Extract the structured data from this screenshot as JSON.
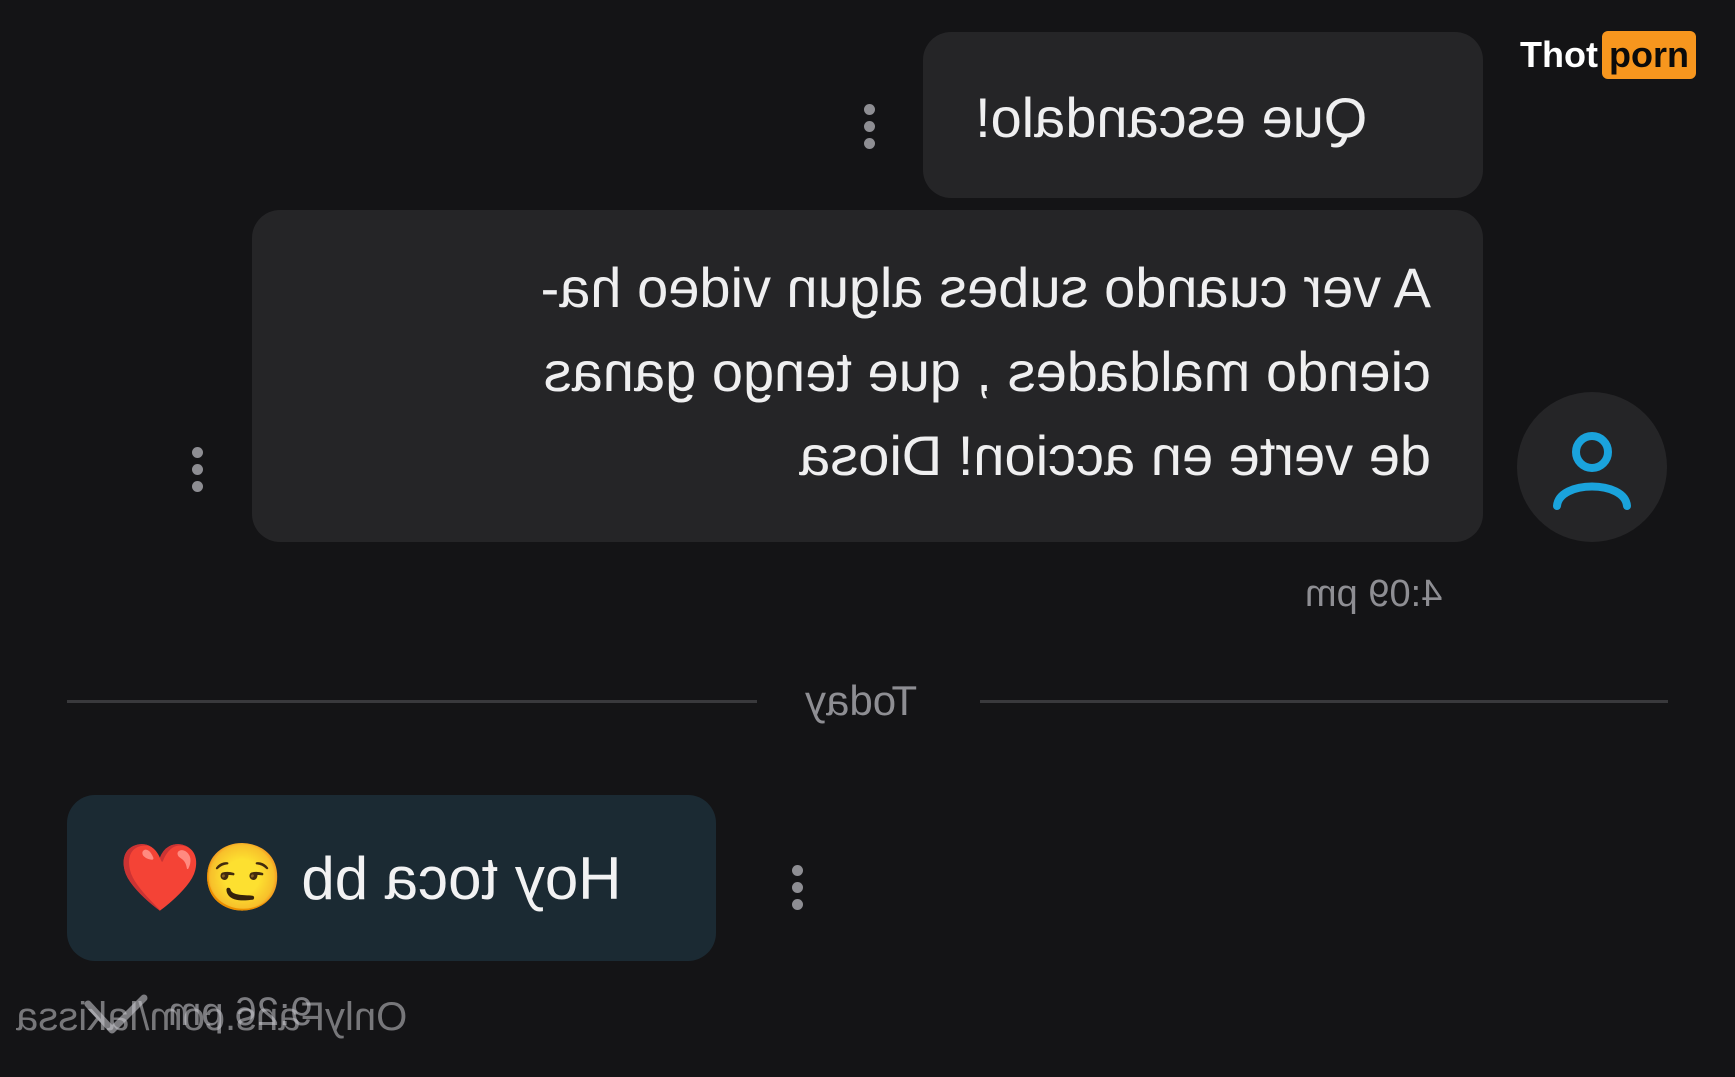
{
  "watermark": {
    "part1": "Thot",
    "part2": "porn",
    "accent": "#f7961e"
  },
  "messages": [
    {
      "text": "Que escandalo!"
    },
    {
      "text": "A ver cuando subes algun video ha-\nciendo maldades , que tengo ganas\nde verte en accion! Diosa"
    }
  ],
  "received_time": "4:09 pm",
  "date_separator": "Today",
  "sent_message": {
    "text": "Hoy toca bb",
    "emoji": "😏❤️"
  },
  "sent_time": "9:26 pm",
  "footer_watermark": "OnlyFans.com/lakissa",
  "colors": {
    "background": "#141416",
    "bubble_received": "#252527",
    "bubble_sent": "#1b2a33",
    "avatar_icon": "#1aa3dc",
    "muted_text": "#8e8e93"
  }
}
